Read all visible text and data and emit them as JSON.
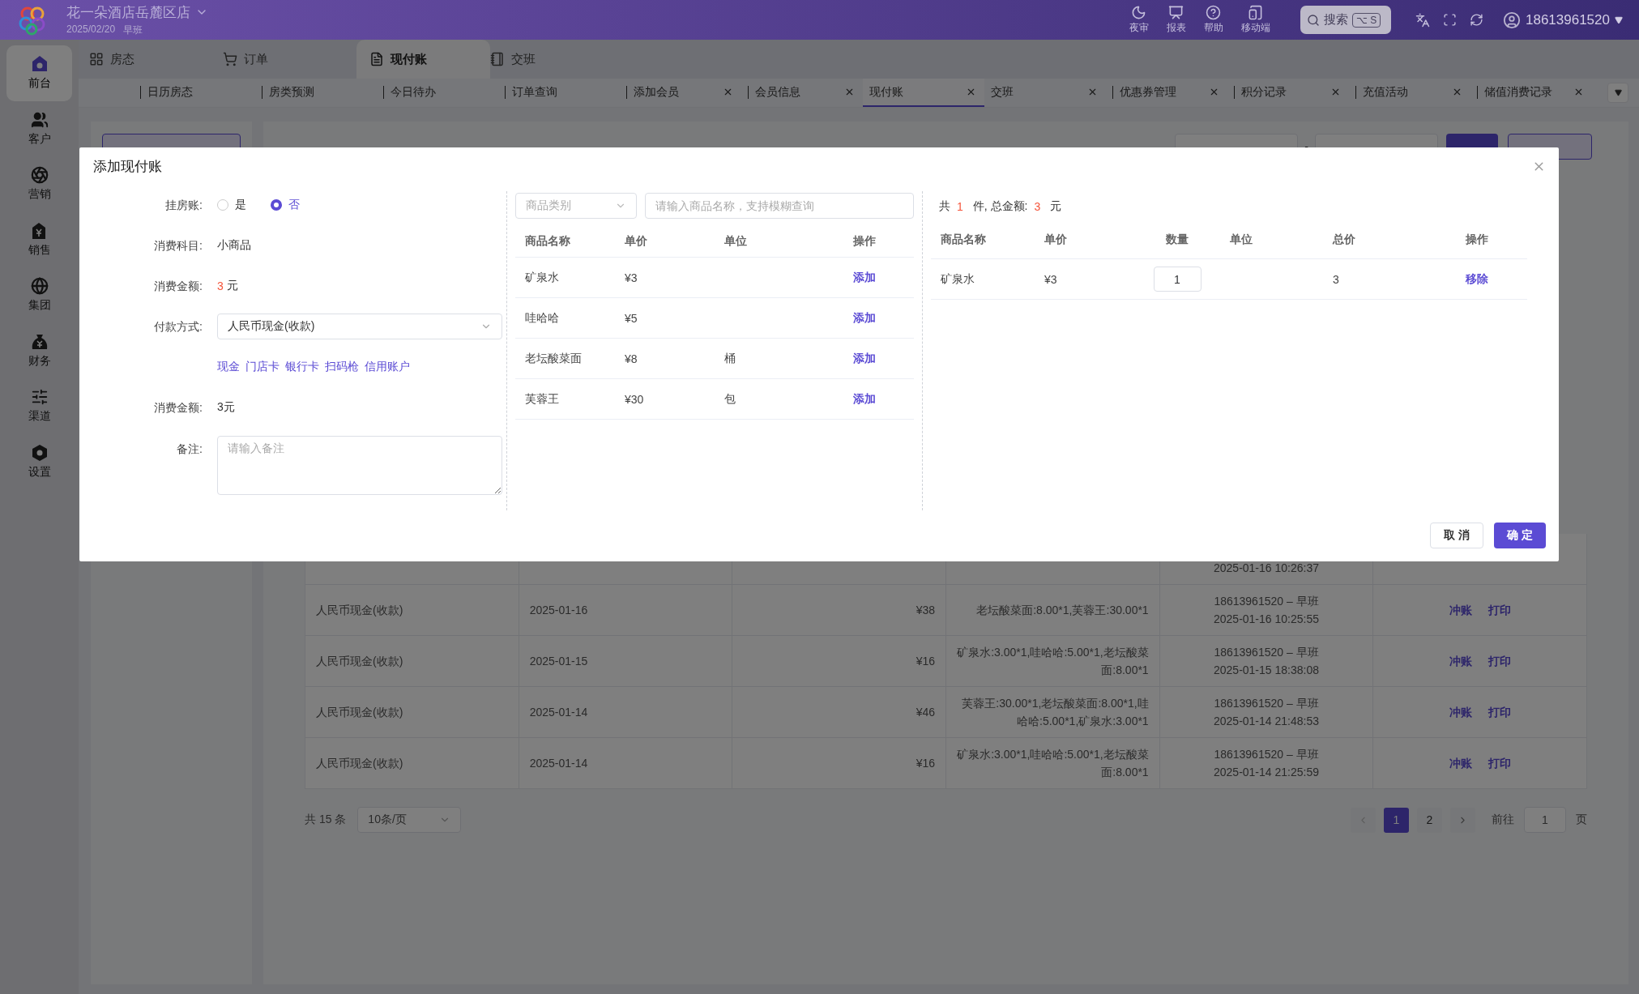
{
  "topbar": {
    "hotel": "花一朵酒店岳麓区店",
    "date": "2025/02/20",
    "shift": "早班",
    "tools": [
      {
        "label": "夜审"
      },
      {
        "label": "报表"
      },
      {
        "label": "帮助"
      },
      {
        "label": "移动端"
      }
    ],
    "search": {
      "label": "搜索",
      "shortcut": "⌥ S"
    },
    "user": "18613961520"
  },
  "sidebar": {
    "items": [
      {
        "label": "前台",
        "selected": true
      },
      {
        "label": "客户",
        "selected": false
      },
      {
        "label": "营销",
        "selected": false
      },
      {
        "label": "销售",
        "selected": false
      },
      {
        "label": "集团",
        "selected": false
      },
      {
        "label": "财务",
        "selected": false
      },
      {
        "label": "渠道",
        "selected": false
      },
      {
        "label": "设置",
        "selected": false
      }
    ]
  },
  "module_tabs": [
    {
      "label": "房态",
      "selected": false
    },
    {
      "label": "订单",
      "selected": false
    },
    {
      "label": "现付账",
      "selected": true
    },
    {
      "label": "交班",
      "selected": false
    }
  ],
  "page_tabs": [
    {
      "label": "日历房态",
      "selected": false,
      "closable": false
    },
    {
      "label": "房类预测",
      "selected": false,
      "closable": false
    },
    {
      "label": "今日待办",
      "selected": false,
      "closable": false
    },
    {
      "label": "订单查询",
      "selected": false,
      "closable": false
    },
    {
      "label": "添加会员",
      "selected": false,
      "closable": true
    },
    {
      "label": "会员信息",
      "selected": false,
      "closable": true
    },
    {
      "label": "现付账",
      "selected": true,
      "closable": true
    },
    {
      "label": "交班",
      "selected": false,
      "closable": true
    },
    {
      "label": "优惠券管理",
      "selected": false,
      "closable": true
    },
    {
      "label": "积分记录",
      "selected": false,
      "closable": true
    },
    {
      "label": "充值活动",
      "selected": false,
      "closable": true
    },
    {
      "label": "储值消费记录",
      "selected": false,
      "closable": true
    }
  ],
  "filter": {
    "separator": "-"
  },
  "table": {
    "rows": [
      {
        "time": "2025-01-16 10:26:37"
      },
      {
        "method": "人民币现金(收款)",
        "date": "2025-01-16",
        "amount": "¥38",
        "goods": "老坛酸菜面:8.00*1,芙蓉王:30.00*1",
        "operator": "18613961520 – 早班",
        "time": "2025-01-16 10:25:55",
        "actions": [
          "冲账",
          "打印"
        ]
      },
      {
        "method": "人民币现金(收款)",
        "date": "2025-01-15",
        "amount": "¥16",
        "goods": "矿泉水:3.00*1,哇哈哈:5.00*1,老坛酸菜面:8.00*1",
        "operator": "18613961520 – 早班",
        "time": "2025-01-15 18:38:08",
        "actions": [
          "冲账",
          "打印"
        ]
      },
      {
        "method": "人民币现金(收款)",
        "date": "2025-01-14",
        "amount": "¥46",
        "goods": "芙蓉王:30.00*1,老坛酸菜面:8.00*1,哇哈哈:5.00*1,矿泉水:3.00*1",
        "operator": "18613961520 – 早班",
        "time": "2025-01-14 21:48:53",
        "actions": [
          "冲账",
          "打印"
        ]
      },
      {
        "method": "人民币现金(收款)",
        "date": "2025-01-14",
        "amount": "¥16",
        "goods": "矿泉水:3.00*1,哇哈哈:5.00*1,老坛酸菜面:8.00*1",
        "operator": "18613961520 – 早班",
        "time": "2025-01-14 21:25:59",
        "actions": [
          "冲账",
          "打印"
        ]
      }
    ]
  },
  "pagination": {
    "total": "共 15 条",
    "page_size": "10条/页",
    "pages": [
      {
        "label": "1",
        "selected": true
      },
      {
        "label": "2",
        "selected": false
      }
    ],
    "goto_label": "前往",
    "goto_value": "1",
    "goto_unit": "页"
  },
  "dialog": {
    "title": "添加现付账",
    "form": [
      {
        "kind": "radio",
        "label": "挂房账:",
        "options": [
          {
            "label": "是",
            "selected": false
          },
          {
            "label": "否",
            "selected": true
          }
        ]
      },
      {
        "kind": "text",
        "label": "消费科目:",
        "value": "小商品"
      },
      {
        "kind": "amount",
        "label": "消费金额:",
        "value": "3",
        "unit": "元"
      },
      {
        "kind": "select",
        "label": "付款方式:",
        "value": "人民币现金(收款)"
      },
      {
        "kind": "links",
        "links": [
          "现金",
          "门店卡",
          "银行卡",
          "扫码枪",
          "信用账户"
        ]
      },
      {
        "kind": "text",
        "label": "消费金额:",
        "value": "3元"
      },
      {
        "kind": "textarea",
        "label": "备注:",
        "placeholder": "请输入备注"
      }
    ],
    "goods": {
      "category_placeholder": "商品类别",
      "search_placeholder": "请输入商品名称，支持模糊查询",
      "columns": [
        "商品名称",
        "单价",
        "单位",
        "操作"
      ],
      "rows": [
        {
          "name": "矿泉水",
          "price": "¥3",
          "action": "添加"
        },
        {
          "name": "哇哈哈",
          "price": "¥5",
          "action": "添加"
        },
        {
          "name": "老坛酸菜面",
          "price": "¥8",
          "unit": "桶",
          "action": "添加"
        },
        {
          "name": "芙蓉王",
          "price": "¥30",
          "unit": "包",
          "action": "添加"
        }
      ]
    },
    "cart": {
      "summary": [
        "共",
        "1",
        "件, 总金额:",
        "3",
        "元"
      ],
      "columns": [
        "商品名称",
        "单价",
        "数量",
        "单位",
        "总价",
        "操作"
      ],
      "rows": [
        {
          "name": "矿泉水",
          "price": "¥3",
          "qty": "1",
          "total": "3",
          "action": "移除"
        }
      ]
    },
    "cancel": "取 消",
    "confirm": "确 定"
  }
}
